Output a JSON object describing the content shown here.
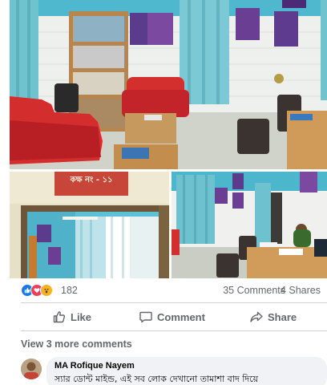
{
  "photos": {
    "room_sign": "কক্ষ নং - ১১"
  },
  "reactions": {
    "icons": [
      "like-icon",
      "love-icon",
      "wow-icon"
    ],
    "count": "182",
    "comments": "35 Comments",
    "shares": "4 Shares"
  },
  "actions": {
    "like": "Like",
    "comment": "Comment",
    "share": "Share"
  },
  "view_more": "View 3 more comments",
  "comment": {
    "author": "MA Rofique Nayem",
    "text": "স্যার ডোন্ট মাইন্ড, এই সব লোক দেখানো তামাশা বাদ দিয়ে"
  },
  "colors": {
    "like_blue": "#1877f2",
    "love_red": "#f33e58",
    "wow_yellow": "#f7b125",
    "muted_text": "#65676b"
  }
}
